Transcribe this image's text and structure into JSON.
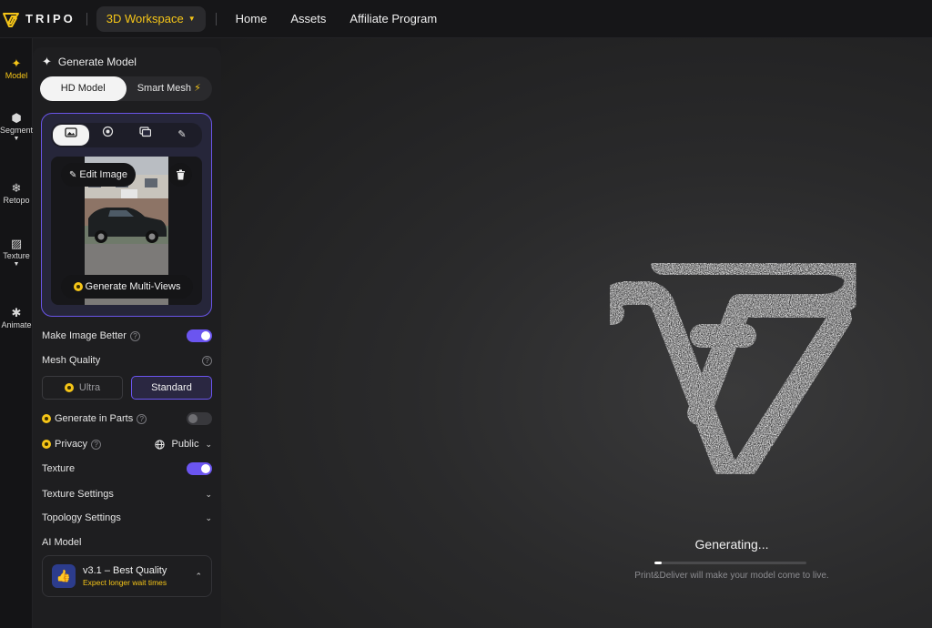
{
  "nav": {
    "brand": "TRIPO",
    "workspace": "3D Workspace",
    "links": [
      "Home",
      "Assets",
      "Affiliate Program"
    ]
  },
  "rail": {
    "items": [
      {
        "label": "Model",
        "icon": "sparkle-icon"
      },
      {
        "label": "Segment",
        "icon": "cube-icon"
      },
      {
        "label": "Retopo",
        "icon": "mesh-icon"
      },
      {
        "label": "Texture",
        "icon": "texture-icon"
      },
      {
        "label": "Animate",
        "icon": "figure-icon"
      }
    ]
  },
  "panel": {
    "title": "Generate Model",
    "modes": {
      "hd": "HD Model",
      "smart": "Smart Mesh"
    },
    "upload": {
      "edit_label": "Edit Image",
      "multi_label": "Generate Multi-Views"
    },
    "make_better": "Make Image Better",
    "mesh_quality": "Mesh Quality",
    "quality_options": {
      "ultra": "Ultra",
      "standard": "Standard"
    },
    "generate_parts": "Generate in Parts",
    "privacy": "Privacy",
    "privacy_value": "Public",
    "texture": "Texture",
    "texture_settings": "Texture Settings",
    "topology_settings": "Topology Settings",
    "ai_model_label": "AI Model",
    "ai_model": {
      "title": "v3.1 – Best Quality",
      "subtitle": "Expect longer wait times"
    }
  },
  "viewport": {
    "status": "Generating...",
    "progress": 0.05,
    "subtitle": "Print&Deliver will make your model come to live."
  },
  "colors": {
    "accent": "#f5c518",
    "purple": "#6b55f0"
  }
}
